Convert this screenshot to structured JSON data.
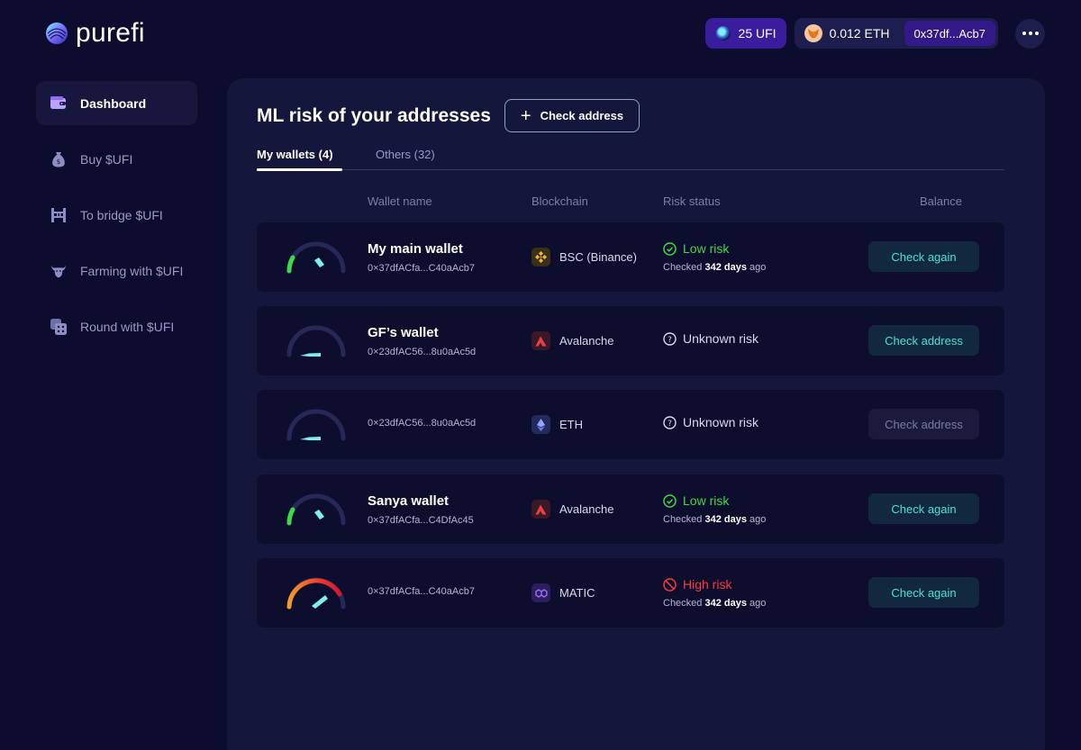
{
  "header": {
    "logo_text": "purefi",
    "ufi_balance": "25 UFI",
    "eth_balance": "0.012 ETH",
    "address": "0x37df...Acb7"
  },
  "sidebar": {
    "items": [
      {
        "label": "Dashboard",
        "icon": "wallet-icon",
        "active": true
      },
      {
        "label": "Buy $UFI",
        "icon": "money-bag-icon",
        "active": false
      },
      {
        "label": "To bridge $UFI",
        "icon": "bridge-icon",
        "active": false
      },
      {
        "label": "Farming with $UFI",
        "icon": "bull-icon",
        "active": false
      },
      {
        "label": "Round with $UFI",
        "icon": "dice-icon",
        "active": false
      }
    ]
  },
  "main": {
    "title": "ML risk of your addresses",
    "check_address_label": "Check address",
    "tabs": [
      {
        "label": "My wallets (4)",
        "active": true
      },
      {
        "label": "Others (32)",
        "active": false
      }
    ],
    "columns": [
      "Wallet name",
      "Blockchain",
      "Risk status",
      "Balance"
    ],
    "rows": [
      {
        "name": "My main wallet",
        "address": "0×37dfACfa...C40aAcb7",
        "chain": "BSC (Binance)",
        "chain_icon": "bnb-icon",
        "risk": "Low risk",
        "risk_level": "low",
        "checked_prefix": "Checked",
        "checked_days": "342 days",
        "checked_suffix": "ago",
        "action": "Check again"
      },
      {
        "name": "GF’s wallet",
        "address": "0×23dfAC56...8u0aAc5d",
        "chain": "Avalanche",
        "chain_icon": "avalanche-icon",
        "risk": "Unknown risk",
        "risk_level": "unknown",
        "action": "Check address"
      },
      {
        "name": "",
        "address": "0×23dfAC56...8u0aAc5d",
        "chain": "ETH",
        "chain_icon": "eth-icon",
        "risk": "Unknown risk",
        "risk_level": "unknown",
        "action": "Check address",
        "disabled": true
      },
      {
        "name": "Sanya wallet",
        "address": "0×37dfACfa...C4DfAc45",
        "chain": "Avalanche",
        "chain_icon": "avalanche-icon",
        "risk": "Low risk",
        "risk_level": "low",
        "checked_prefix": "Checked",
        "checked_days": "342 days",
        "checked_suffix": "ago",
        "action": "Check again"
      },
      {
        "name": "",
        "address": "0×37dfACfa...C40aAcb7",
        "chain": "MATIC",
        "chain_icon": "matic-icon",
        "risk": "High risk",
        "risk_level": "high",
        "checked_prefix": "Checked",
        "checked_days": "342 days",
        "checked_suffix": "ago",
        "action": "Check again"
      }
    ]
  },
  "colors": {
    "background": "#0c0c2e",
    "panel": "#15163b",
    "row": "#0d0d2d",
    "low_risk": "#3ed94a",
    "high_risk": "#ff3b3b",
    "unknown_risk": "#d8d9ee",
    "accent_teal": "#4de0d6",
    "ufi_pill": "#3a1d9c"
  }
}
